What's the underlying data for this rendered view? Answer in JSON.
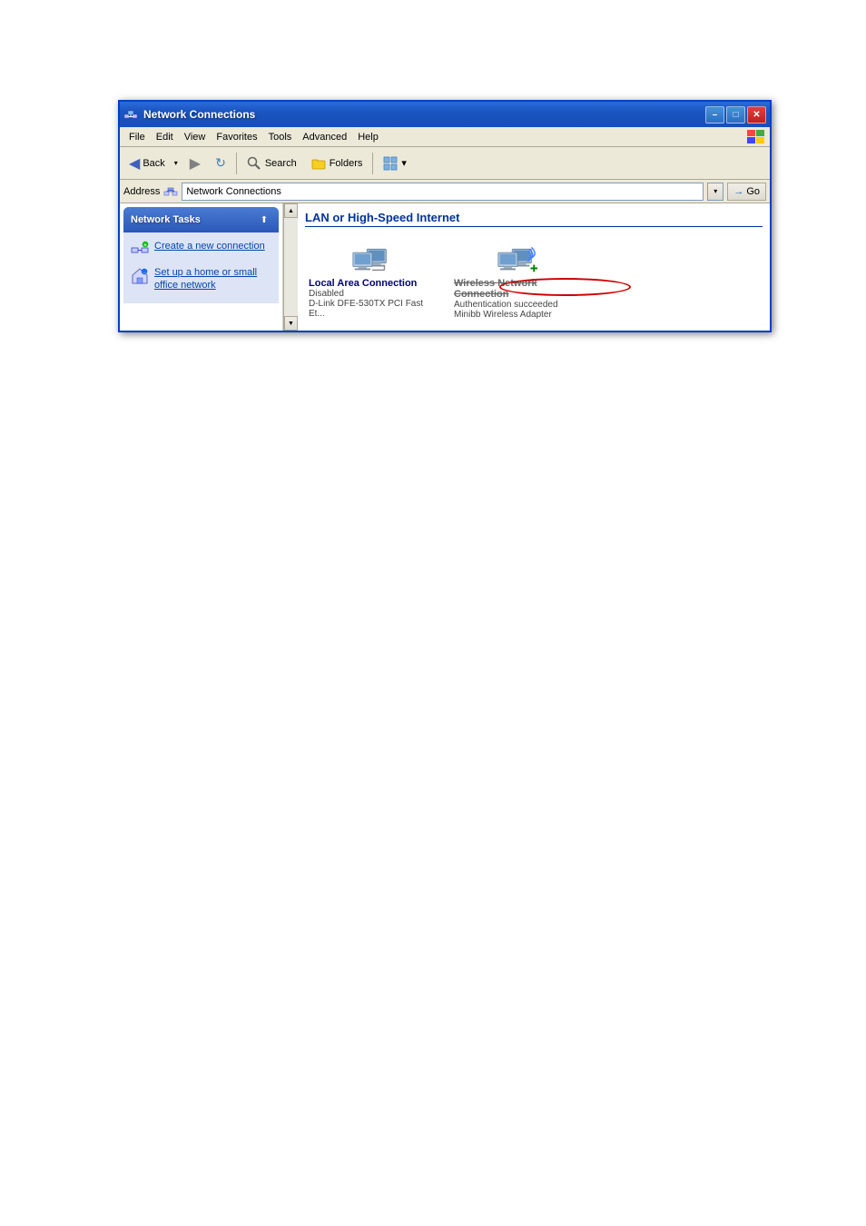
{
  "window": {
    "title": "Network Connections",
    "icon": "network-icon"
  },
  "title_buttons": {
    "minimize": "–",
    "maximize": "□",
    "close": "✕"
  },
  "menu": {
    "items": [
      "File",
      "Edit",
      "View",
      "Favorites",
      "Tools",
      "Advanced",
      "Help"
    ]
  },
  "toolbar": {
    "back_label": "Back",
    "forward_arrow": "▶",
    "search_label": "Search",
    "folders_label": "Folders",
    "views_label": "▾"
  },
  "address_bar": {
    "label": "Address",
    "value": "Network Connections",
    "go_label": "Go"
  },
  "sidebar": {
    "section_title": "Network Tasks",
    "collapse_icon": "⬆",
    "links": [
      {
        "label": "Create a new connection",
        "icon": "new-connection-icon"
      },
      {
        "label": "Set up a home or small office network",
        "icon": "home-network-icon"
      }
    ]
  },
  "main": {
    "section_title": "LAN or High-Speed Internet",
    "connections": [
      {
        "name": "Local Area Connection",
        "status": "Disabled",
        "device": "D-Link DFE-530TX PCI Fast Et...",
        "strikethrough": false
      },
      {
        "name": "Wireless Network Connection",
        "status": "Authentication succeeded",
        "device": "Minibb Wireless Adapter",
        "strikethrough": true
      }
    ]
  }
}
